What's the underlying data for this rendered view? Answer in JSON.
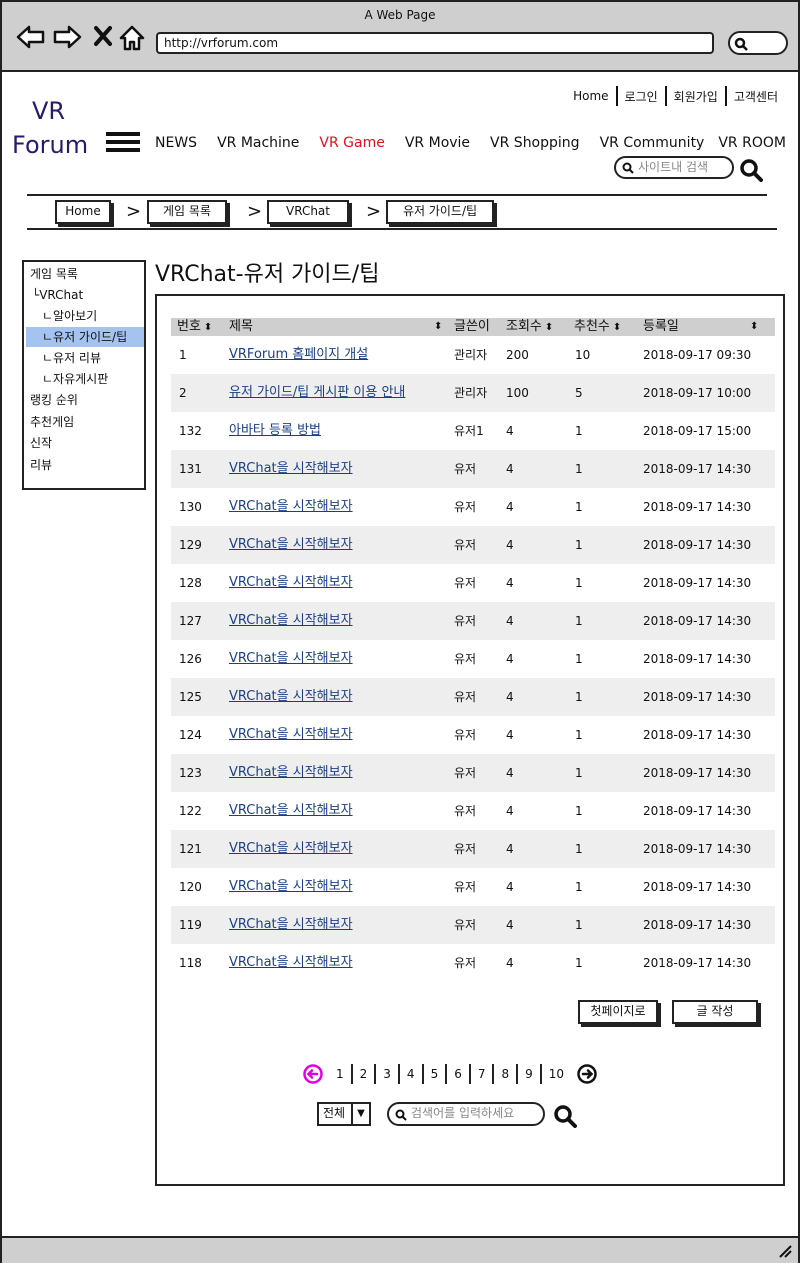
{
  "browser": {
    "title": "A Web Page",
    "url": "http://vrforum.com"
  },
  "logo": {
    "line1": "VR",
    "line2": "Forum"
  },
  "top_links": [
    "Home",
    "로그인",
    "회원가입",
    "고객센터"
  ],
  "main_nav": [
    {
      "label": "NEWS",
      "active": false
    },
    {
      "label": "VR Machine",
      "active": false
    },
    {
      "label": "VR Game",
      "active": true
    },
    {
      "label": "VR Movie",
      "active": false
    },
    {
      "label": "VR Shopping",
      "active": false
    },
    {
      "label": "VR Community",
      "active": false
    },
    {
      "label": "VR ROOM",
      "active": false
    }
  ],
  "site_search": {
    "placeholder": "사이트내 검색"
  },
  "breadcrumb": [
    "Home",
    "게임 목록",
    "VRChat",
    "유저 가이드/팁"
  ],
  "sidebar": [
    {
      "label": "게임 목록",
      "level": 0
    },
    {
      "label": "└VRChat",
      "level": 1
    },
    {
      "label": "ㄴ알아보기",
      "level": 2
    },
    {
      "label": "ㄴ유저 가이드/팁",
      "level": 2,
      "selected": true
    },
    {
      "label": "ㄴ유저 리뷰",
      "level": 2
    },
    {
      "label": "ㄴ자유게시판",
      "level": 2
    },
    {
      "label": "랭킹 순위",
      "level": 0
    },
    {
      "label": "추천게임",
      "level": 0
    },
    {
      "label": "신작",
      "level": 0
    },
    {
      "label": "리뷰",
      "level": 0
    }
  ],
  "page_title": "VRChat-유저 가이드/팁",
  "table": {
    "headers": [
      "번호",
      "제목",
      "글쓴이",
      "조회수",
      "추천수",
      "등록일"
    ],
    "rows": [
      [
        "1",
        "VRForum 홈페이지 개설",
        "관리자",
        "200",
        "10",
        "2018-09-17 09:30"
      ],
      [
        "2",
        "유저 가이드/팁 게시판 이용 안내",
        "관리자",
        "100",
        "5",
        "2018-09-17 10:00"
      ],
      [
        "132",
        "아바타 등록 방법",
        "유저1",
        "4",
        "1",
        "2018-09-17 15:00"
      ],
      [
        "131",
        "VRChat을 시작해보자",
        "유저",
        "4",
        "1",
        "2018-09-17 14:30"
      ],
      [
        "130",
        "VRChat을 시작해보자",
        "유저",
        "4",
        "1",
        "2018-09-17 14:30"
      ],
      [
        "129",
        "VRChat을 시작해보자",
        "유저",
        "4",
        "1",
        "2018-09-17 14:30"
      ],
      [
        "128",
        "VRChat을 시작해보자",
        "유저",
        "4",
        "1",
        "2018-09-17 14:30"
      ],
      [
        "127",
        "VRChat을 시작해보자",
        "유저",
        "4",
        "1",
        "2018-09-17 14:30"
      ],
      [
        "126",
        "VRChat을 시작해보자",
        "유저",
        "4",
        "1",
        "2018-09-17 14:30"
      ],
      [
        "125",
        "VRChat을 시작해보자",
        "유저",
        "4",
        "1",
        "2018-09-17 14:30"
      ],
      [
        "124",
        "VRChat을 시작해보자",
        "유저",
        "4",
        "1",
        "2018-09-17 14:30"
      ],
      [
        "123",
        "VRChat을 시작해보자",
        "유저",
        "4",
        "1",
        "2018-09-17 14:30"
      ],
      [
        "122",
        "VRChat을 시작해보자",
        "유저",
        "4",
        "1",
        "2018-09-17 14:30"
      ],
      [
        "121",
        "VRChat을 시작해보자",
        "유저",
        "4",
        "1",
        "2018-09-17 14:30"
      ],
      [
        "120",
        "VRChat을 시작해보자",
        "유저",
        "4",
        "1",
        "2018-09-17 14:30"
      ],
      [
        "119",
        "VRChat을 시작해보자",
        "유저",
        "4",
        "1",
        "2018-09-17 14:30"
      ],
      [
        "118",
        "VRChat을 시작해보자",
        "유저",
        "4",
        "1",
        "2018-09-17 14:30"
      ]
    ]
  },
  "buttons": {
    "first_page": "첫페이지로",
    "write": "글 작성"
  },
  "pagination": {
    "pages": [
      "1",
      "2",
      "3",
      "4",
      "5",
      "6",
      "7",
      "8",
      "9",
      "10"
    ]
  },
  "board_search": {
    "scope": "전체",
    "placeholder": "검색어를 입력하세요"
  },
  "colors": {
    "active_nav": "#e0121c",
    "logo": "#2a1a6e",
    "link": "#1a3f88",
    "selected": "#a4c3f0",
    "prev_arrow": "#e000e0"
  }
}
